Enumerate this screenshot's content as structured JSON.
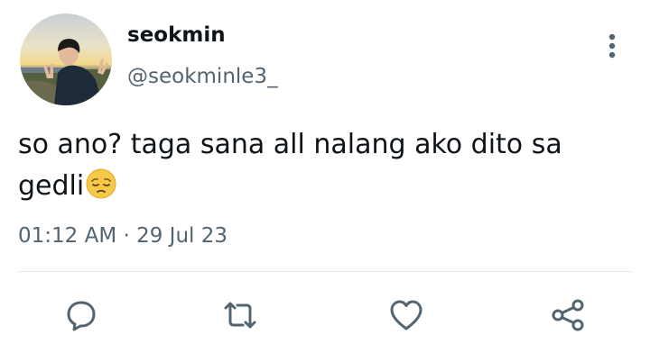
{
  "author": {
    "display_name": "seokmin",
    "handle": "@seokminle3_",
    "avatar_icon": "profile-photo"
  },
  "tweet": {
    "text": "so ano? taga sana all nalang ako dito sa gedli",
    "emoji": "pensive-face-emoji",
    "timestamp": "01:12 AM · 29 Jul 23"
  },
  "actions": {
    "reply_icon": "reply-icon",
    "retweet_icon": "retweet-icon",
    "like_icon": "heart-icon",
    "share_icon": "share-icon",
    "more_icon": "more-vertical-icon"
  },
  "colors": {
    "primary_text": "#0f1419",
    "secondary_text": "#536471",
    "divider": "#e6e9eb",
    "icon": "#536471"
  }
}
